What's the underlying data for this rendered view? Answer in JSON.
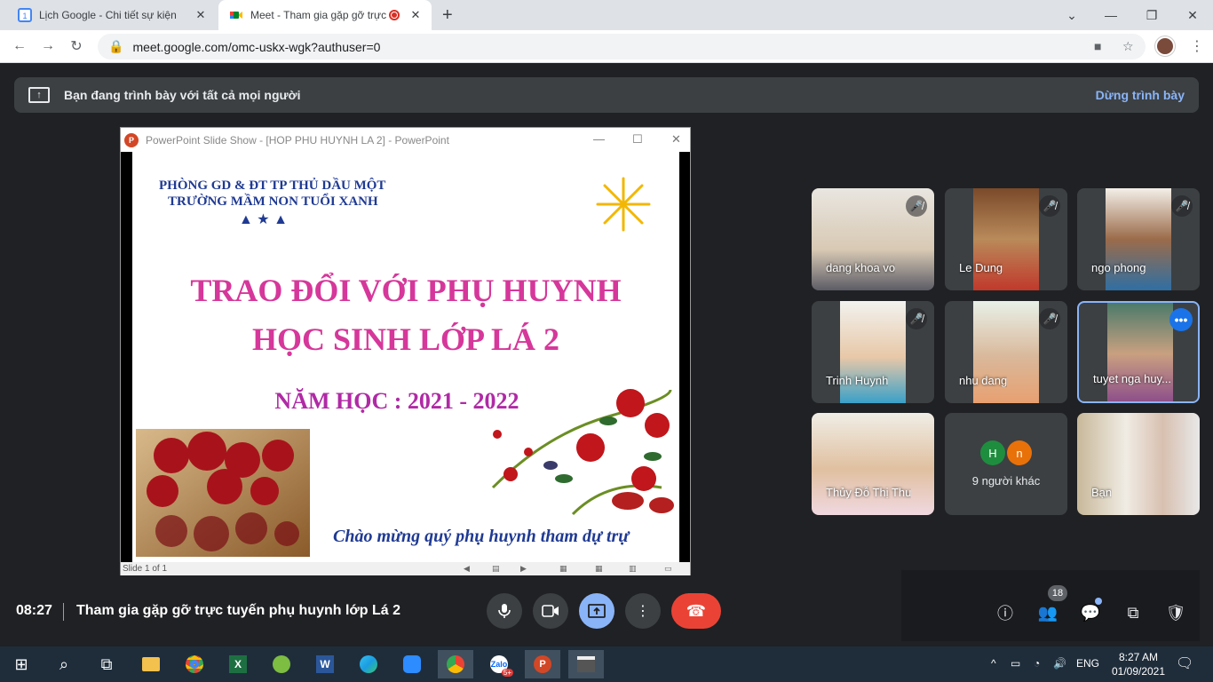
{
  "browser": {
    "tabs": [
      {
        "title": "Lịch Google - Chi tiết sự kiện",
        "icon": "google-calendar-icon"
      },
      {
        "title": "Meet - Tham gia gặp gỡ trực",
        "icon": "google-meet-icon",
        "recording": true
      }
    ],
    "url": "meet.google.com/omc-uskx-wgk?authuser=0"
  },
  "banner": {
    "text": "Bạn đang trình bày với tất cả mọi người",
    "stop_label": "Dừng trình bày"
  },
  "ppt": {
    "window_title": "PowerPoint Slide Show - [HOP PHU HUYNH LA 2] - PowerPoint",
    "status": "Slide 1 of 1",
    "slide": {
      "school_line1": "PHÒNG GD & ĐT TP THỦ DẦU MỘT",
      "school_line2": "TRƯỜNG MẦM NON TUỔI XANH",
      "title1": "TRAO ĐỔI VỚI PHỤ HUYNH",
      "title2": "HỌC SINH LỚP LÁ 2",
      "year": "NĂM HỌC : 2021 - 2022",
      "welcome": "Chào mừng quý phụ huynh tham dự trự"
    }
  },
  "participants": [
    {
      "name": "dang khoa vo",
      "muted": true
    },
    {
      "name": "Le Dung",
      "muted": true
    },
    {
      "name": "ngo phong",
      "muted": true
    },
    {
      "name": "Trinh Huynh",
      "muted": true
    },
    {
      "name": "nhu dang",
      "muted": true
    },
    {
      "name": "tuyet nga huy...",
      "muted": false,
      "active": true
    },
    {
      "name": "Thủy Đỗ Thị Thu",
      "muted": false
    },
    {
      "name": "Bạn",
      "muted": false
    }
  ],
  "others": {
    "label": "9 người khác",
    "initials": [
      "H",
      "n"
    ],
    "colors": [
      "#1e8e3e",
      "#e8710a"
    ]
  },
  "meeting": {
    "time": "08:27",
    "title": "Tham gia gặp gỡ trực tuyến phụ huynh lớp Lá 2",
    "participant_count": "18"
  },
  "taskbar": {
    "lang": "ENG",
    "time": "8:27 AM",
    "date": "01/09/2021",
    "zalo_badge": "5+"
  }
}
